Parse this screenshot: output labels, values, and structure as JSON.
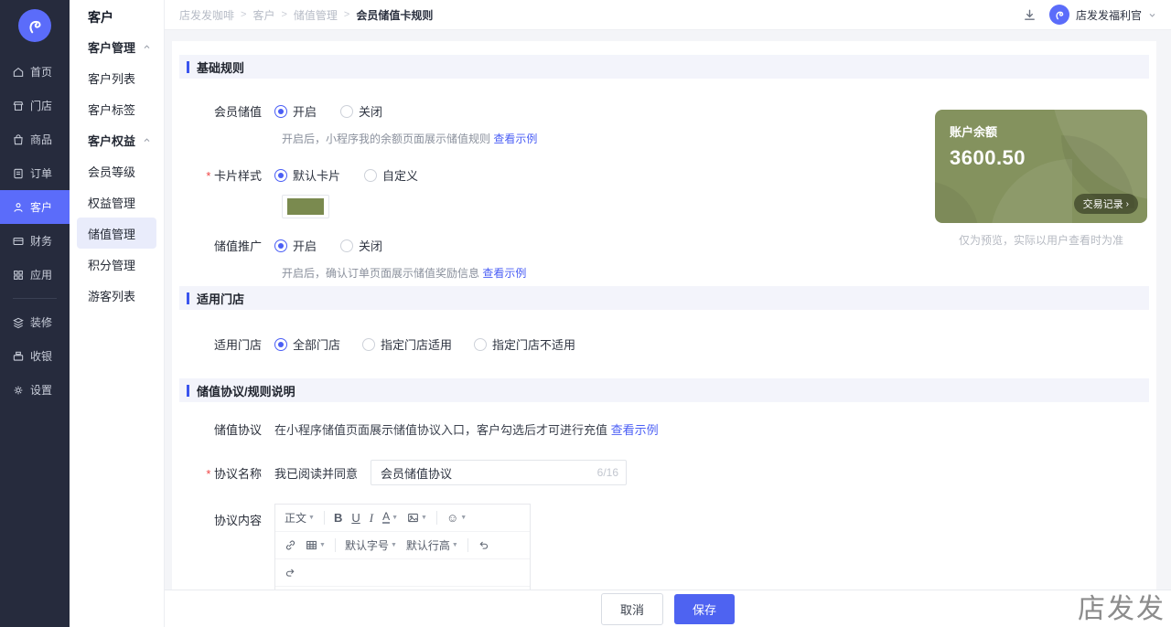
{
  "colors": {
    "accent": "#5b6cfa",
    "sidebar_bg": "#262b3d",
    "card_green": "#84925e",
    "link_blue": "#4a5ef5",
    "swatch_green": "#7a8a4f"
  },
  "watermark": "店发发",
  "topbar": {
    "breadcrumb": [
      "店发发咖啡",
      "客户",
      "储值管理",
      "会员储值卡规则"
    ],
    "user_name": "店发发福利官"
  },
  "nav": {
    "items": [
      {
        "label": "首页"
      },
      {
        "label": "门店"
      },
      {
        "label": "商品"
      },
      {
        "label": "订单"
      },
      {
        "label": "客户"
      },
      {
        "label": "财务"
      },
      {
        "label": "应用"
      },
      {
        "label": "装修"
      },
      {
        "label": "收银"
      },
      {
        "label": "设置"
      }
    ]
  },
  "submenu": {
    "title": "客户",
    "group_management": "客户管理",
    "group_benefits": "客户权益",
    "items": {
      "customer_list": "客户列表",
      "customer_tags": "客户标签",
      "member_level": "会员等级",
      "benefit_management": "权益管理",
      "stored_value": "储值管理",
      "points": "积分管理",
      "visitor_list": "游客列表"
    }
  },
  "basic": {
    "title": "基础规则",
    "member_stored": {
      "label": "会员储值",
      "opt_on": "开启",
      "opt_off": "关闭",
      "helper": "开启后，小程序我的余额页面展示储值规则",
      "link": "查看示例"
    },
    "card_style": {
      "label": "卡片样式",
      "opt_default": "默认卡片",
      "opt_custom": "自定义"
    },
    "promotion": {
      "label": "储值推广",
      "opt_on": "开启",
      "opt_off": "关闭",
      "helper": "开启后，确认订单页面展示储值奖励信息",
      "link": "查看示例"
    }
  },
  "preview": {
    "balance_label": "账户余额",
    "balance_value": "3600.50",
    "records_button": "交易记录",
    "note": "仅为预览，实际以用户查看时为准"
  },
  "stores": {
    "title": "适用门店",
    "label": "适用门店",
    "opt_all": "全部门店",
    "opt_include": "指定门店适用",
    "opt_exclude": "指定门店不适用"
  },
  "agreement": {
    "title": "储值协议/规则说明",
    "entry": {
      "label": "储值协议",
      "desc": "在小程序储值页面展示储值协议入口，客户勾选后才可进行充值",
      "link": "查看示例"
    },
    "name": {
      "label": "协议名称",
      "prefix": "我已阅读并同意",
      "value": "会员储值协议",
      "counter": "6/16"
    },
    "content": {
      "label": "协议内容"
    },
    "toolbar": {
      "paragraph": "正文",
      "bold": "B",
      "underline": "U",
      "italic": "I",
      "color": "A",
      "font_size": "默认字号",
      "line_height": "默认行高",
      "emoji_glyph": "☺"
    }
  },
  "footer": {
    "cancel": "取消",
    "save": "保存"
  }
}
